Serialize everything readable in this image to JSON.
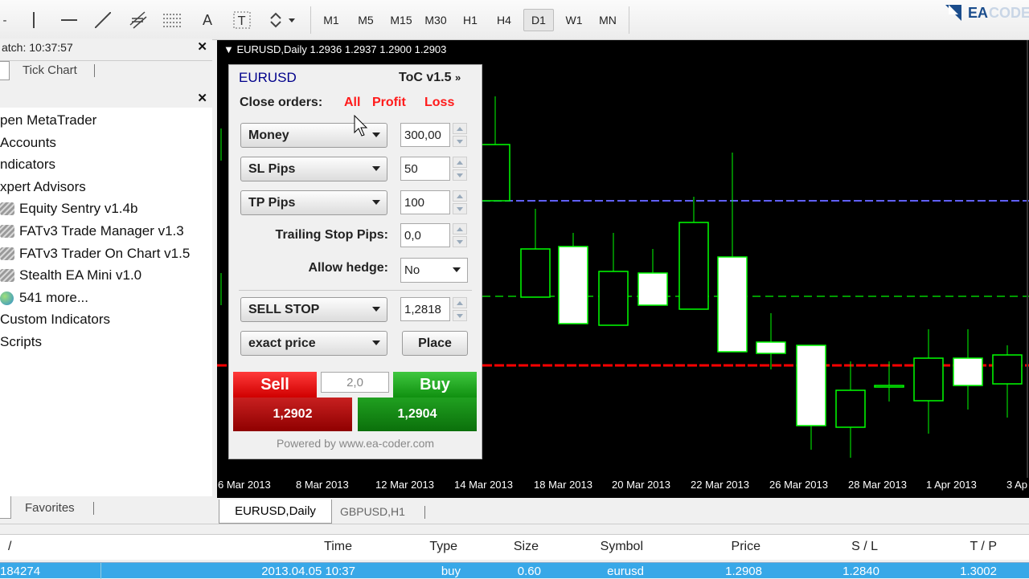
{
  "toolbar": {
    "timeframes": [
      "M1",
      "M5",
      "M15",
      "M30",
      "H1",
      "H4",
      "D1",
      "W1",
      "MN"
    ],
    "active_timeframe": "D1",
    "logo_text": "EA CODER"
  },
  "market_watch": {
    "title": "atch: 10:37:57",
    "tab": "Tick Chart"
  },
  "navigator": {
    "items": [
      {
        "label": "pen MetaTrader"
      },
      {
        "label": "Accounts"
      },
      {
        "label": "ndicators"
      },
      {
        "label": "xpert Advisors"
      },
      {
        "label": "Equity Sentry v1.4b"
      },
      {
        "label": "FATv3 Trade Manager v1.3"
      },
      {
        "label": "FATv3 Trader On Chart v1.5"
      },
      {
        "label": "Stealth EA Mini v1.0"
      },
      {
        "label": "541 more..."
      },
      {
        "label": "Custom Indicators"
      },
      {
        "label": "Scripts"
      }
    ],
    "tab_favorites": "Favorites"
  },
  "chart": {
    "title": "EURUSD,Daily  1.2936 1.2937 1.2900 1.2903",
    "dates": [
      "6 Mar 2013",
      "8 Mar 2013",
      "12 Mar 2013",
      "14 Mar 2013",
      "18 Mar 2013",
      "20 Mar 2013",
      "22 Mar 2013",
      "26 Mar 2013",
      "28 Mar 2013",
      "1 Apr 2013",
      "3 Ap"
    ],
    "colors": {
      "bull": "#ffffff",
      "bear": "#000000",
      "wick": "#00ff00",
      "bid": "#ff0000",
      "level": "#6060ff",
      "dashed": "#00cc00"
    }
  },
  "panel": {
    "symbol": "EURUSD",
    "version": "ToC v1.5",
    "close_label": "Close orders:",
    "close_all": "All",
    "close_profit": "Profit",
    "close_loss": "Loss",
    "money_label": "Money",
    "money_value": "300,00",
    "sl_label": "SL Pips",
    "sl_value": "50",
    "tp_label": "TP Pips",
    "tp_value": "100",
    "trailing_label": "Trailing Stop Pips:",
    "trailing_value": "0,0",
    "hedge_label": "Allow hedge:",
    "hedge_value": "No",
    "order_type": "SELL STOP",
    "order_price": "1,2818",
    "price_mode": "exact price",
    "place_label": "Place",
    "sell_label": "Sell",
    "buy_label": "Buy",
    "lots": "2,0",
    "sell_price": "1,2902",
    "buy_price": "1,2904",
    "powered": "Powered by www.ea-coder.com"
  },
  "doc_tabs": [
    "EURUSD,Daily",
    "GBPUSD,H1"
  ],
  "terminal": {
    "columns": [
      "/",
      "Time",
      "Type",
      "Size",
      "Symbol",
      "Price",
      "S / L",
      "T / P"
    ],
    "row": [
      "184274",
      "2013.04.05 10:37",
      "buy",
      "0.60",
      "eurusd",
      "1.2908",
      "1.2840",
      "1.3002"
    ]
  }
}
